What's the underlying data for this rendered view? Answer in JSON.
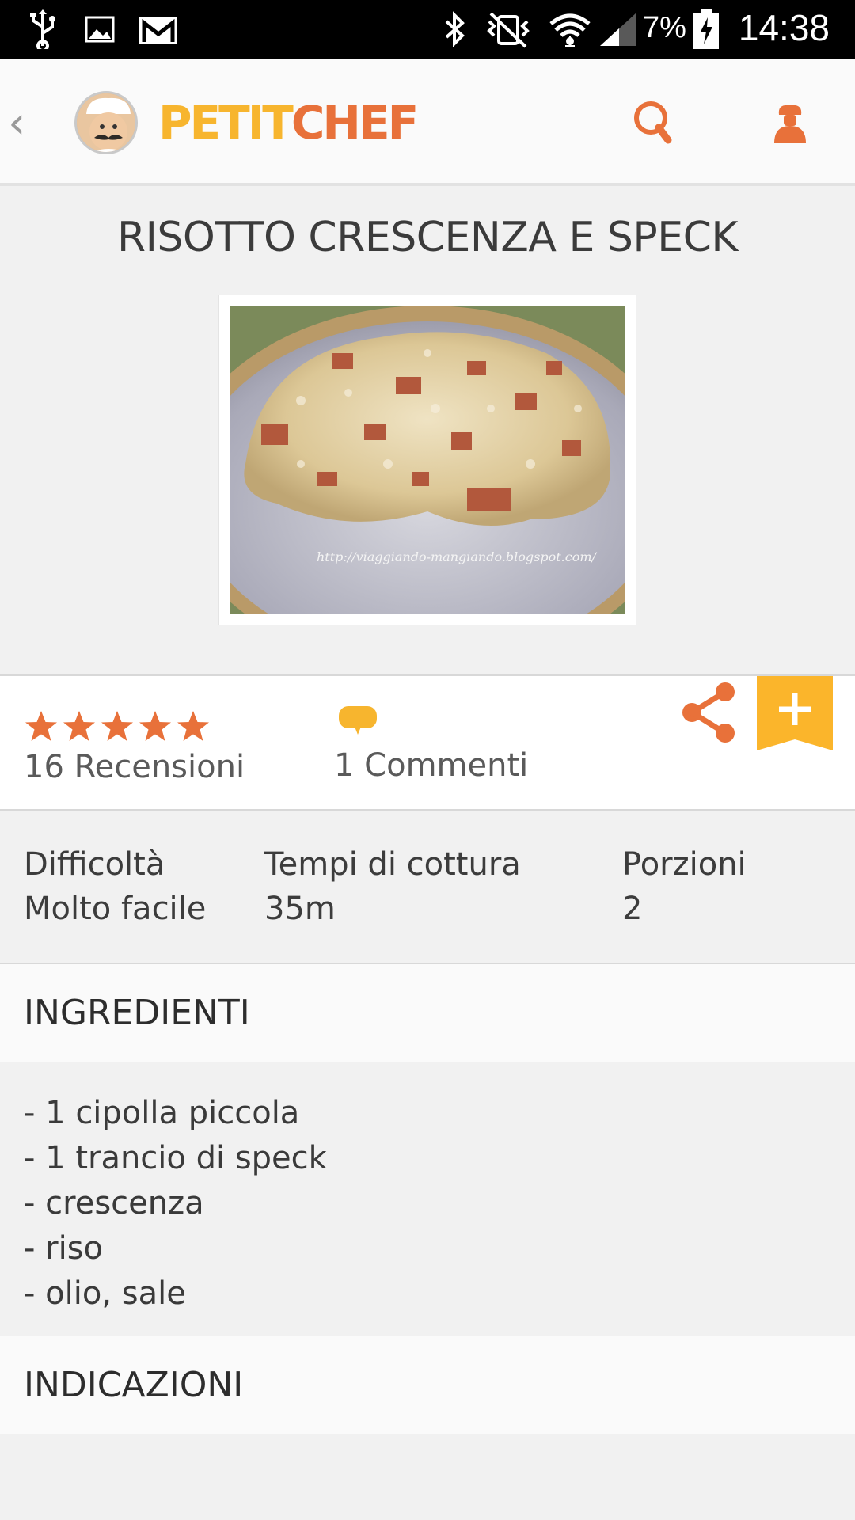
{
  "status_bar": {
    "battery_percent": "7%",
    "time": "14:38",
    "icons": [
      "usb-icon",
      "image-icon",
      "gmail-icon",
      "bluetooth-icon",
      "vibrate-icon",
      "wifi-icon",
      "signal-icon",
      "battery-icon"
    ]
  },
  "header": {
    "logo_part1": "PETIT",
    "logo_part2": "CHEF",
    "colors": {
      "yellow": "#f7b52e",
      "orange": "#e8713a"
    }
  },
  "recipe": {
    "title": "RISOTTO CRESCENZA E SPECK",
    "photo_caption": "http://viaggiando-mangiando.blogspot.com/",
    "rating_stars": 5,
    "reviews_count": "16",
    "reviews_label": "Recensioni",
    "comments_count": "1",
    "comments_label": "Commenti"
  },
  "info": {
    "difficulty_label": "Difficoltà",
    "difficulty_value": "Molto facile",
    "time_label": "Tempi di cottura",
    "time_value": "35m",
    "servings_label": "Porzioni",
    "servings_value": "2"
  },
  "sections": {
    "ingredients_title": "INGREDIENTI",
    "ingredients": [
      "- 1 cipolla piccola",
      "- 1 trancio di speck",
      "- crescenza",
      "- riso",
      "- olio, sale"
    ],
    "directions_title": "INDICAZIONI"
  }
}
